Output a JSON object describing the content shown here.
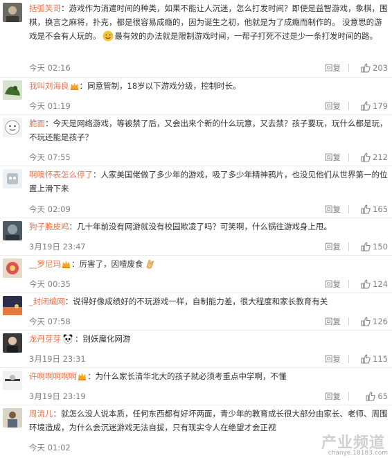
{
  "comments": [
    {
      "user": "括弧笑哥",
      "vip": false,
      "text": "：游戏作为消遣时间的种类，如果不能让人沉迷，怎么打发时间？即使是益智游戏，象棋，围棋，换言之麻将，扑克，都是很容易成瘾的，因为诞生之初，他就是为了成瘾而制作的。 没意思的游戏是不会有人玩的。",
      "emoji": "sweat-smile-emoji",
      "text2": "最有效的办法就是限制游戏时间，一帮子打死不过是少一条打发时间的路。",
      "time": "今天 02:16",
      "reply": "回复",
      "likes": "203"
    },
    {
      "user": "我叫刘海良",
      "vip": true,
      "text": "：同意管制，18岁以下游戏分级，控制时长。",
      "time": "今天 01:19",
      "reply": "回复",
      "likes": "179"
    },
    {
      "user": "脆面",
      "vip": false,
      "text": "：今天是网络游戏，等被禁了后，又会出来个新的什么玩意，又去禁？孩子要玩，玩什么都是玩，不玩还能是孩子？",
      "time": "今天 07:55",
      "reply": "回复",
      "likes": "212"
    },
    {
      "user": "啊噢怀表怎么停了",
      "vip": false,
      "text": "：人家美国佬做了多少年的游戏，吸了多少年精神鸦片，也没见他们从世界第一的位置上滑下来",
      "time": "今天 02:09",
      "reply": "回复",
      "likes": "165"
    },
    {
      "user": "狗子脆皮鸡",
      "vip": false,
      "text": "：几十年前没有网游就没有校园欺凌了吗？可笑啊，什么锅往游戏身上甩。",
      "time": "3月19日 23:47",
      "reply": "回复",
      "likes": "150"
    },
    {
      "user": "__罗尼玛",
      "vip": true,
      "text": "：厉害了，因噎废食",
      "emoji": "clap-emoji",
      "time": "今天 00:35",
      "reply": "回复",
      "likes": "124"
    },
    {
      "user": "_封闭编网",
      "vip": false,
      "text": "：说得好像成绩好的不玩游戏一样，自制能力差，很大程度和家长教育有关",
      "time": "今天 07:58",
      "reply": "回复",
      "likes": "126"
    },
    {
      "user": "龙丹芽芽",
      "vip": false,
      "emoji": "panda-emoji",
      "text": "：别妖魔化网游",
      "time": "3月19日 23:31",
      "reply": "回复",
      "likes": "115"
    },
    {
      "user": "许啊啊啊啊啊",
      "vip": true,
      "text": "：为什么家长清华北大的孩子就必须考重点中学啊，不懂",
      "time": "3月19日 23:19",
      "reply": "回复",
      "likes": "65"
    },
    {
      "user": "周流儿",
      "vip": false,
      "text": "：就怎么没人说本质，任何东西都有好坏两面，青少年的教育成长很大部分由家长、老师、周围环境造成，为什么会沉迷游戏无法自拔，只有现实令人在绝望才会正视",
      "time": "今天 01:02",
      "reply": "回复",
      "likes": ""
    }
  ],
  "watermark": {
    "title": "产业频道",
    "url": "chanye.18183.com"
  }
}
